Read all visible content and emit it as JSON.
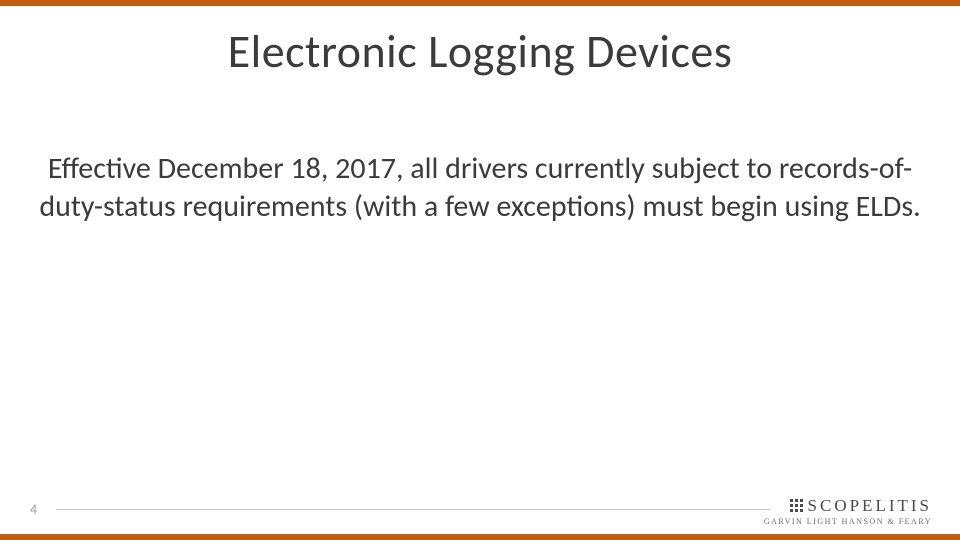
{
  "slide": {
    "title": "Electronic Logging Devices",
    "body": "Effective December 18, 2017, all drivers currently subject to records-of-duty-status requirements (with a few exceptions) must begin using ELDs.",
    "page_number": "4"
  },
  "branding": {
    "name": "SCOPELITIS",
    "tagline": "GARVIN LIGHT HANSON & FEARY"
  },
  "colors": {
    "accent": "#c55a11",
    "text": "#3b3b3b",
    "muted": "#9e9e9e"
  }
}
